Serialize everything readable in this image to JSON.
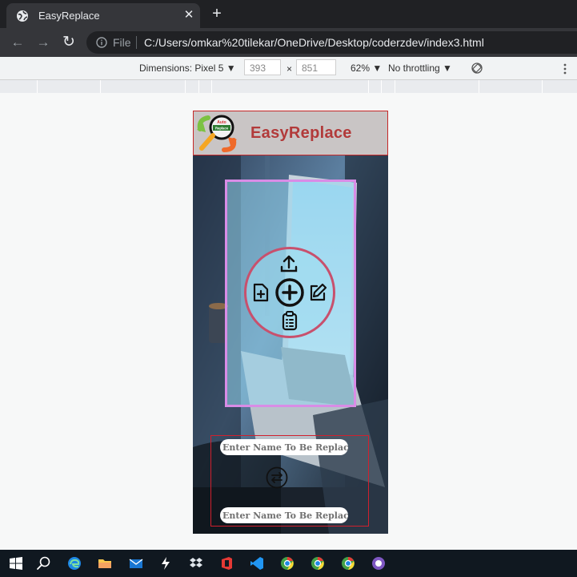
{
  "browser": {
    "tab_title": "EasyReplace",
    "close_glyph": "✕",
    "newtab_glyph": "+",
    "back_glyph": "←",
    "forward_glyph": "→",
    "reload_glyph": "↻",
    "file_label": "File",
    "url": "C:/Users/omkar%20tilekar/OneDrive/Desktop/coderzdev/index3.html"
  },
  "devtools": {
    "dimensions_label": "Dimensions: Pixel 5 ▼",
    "width": "393",
    "times": "×",
    "height": "851",
    "zoom": "62% ▼",
    "throttling": "No throttling ▼"
  },
  "app": {
    "title": "EasyReplace",
    "logo_text_top": "Auto",
    "logo_text_bottom": "Replace",
    "find_placeholder": "Enter Name To Be Replace",
    "replace_placeholder": "Enter Name To Be Replace",
    "accent": "#b23a3a",
    "panel_border": "#d98ce6"
  },
  "icons": [
    "upload-icon",
    "add-file-icon",
    "add-circle-icon",
    "edit-icon",
    "clipboard-list-icon",
    "swap-icon"
  ],
  "taskbar": [
    "windows-start",
    "search",
    "edge",
    "file-explorer",
    "mail",
    "winamp",
    "dropbox",
    "office",
    "vscode",
    "chrome",
    "chrome",
    "chrome",
    "github-desktop"
  ]
}
